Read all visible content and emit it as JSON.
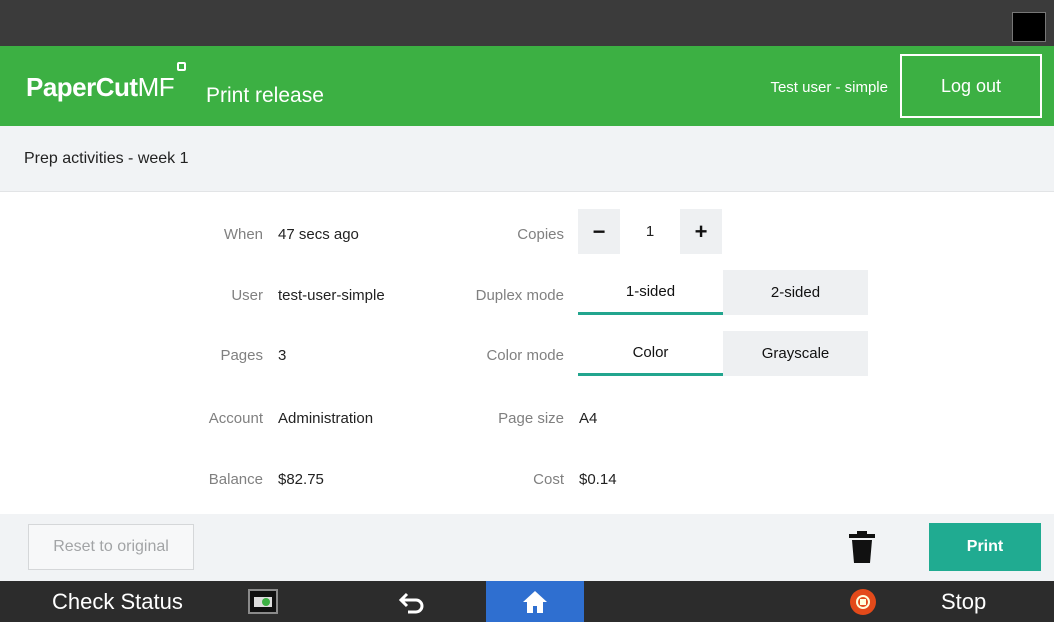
{
  "header": {
    "brand_main": "PaperCut",
    "brand_suffix": "MF",
    "title": "Print release",
    "user": "Test user - simple",
    "logout_label": "Log out"
  },
  "job": {
    "name": "Prep activities - week 1"
  },
  "details": {
    "when_label": "When",
    "when_value": "47 secs ago",
    "user_label": "User",
    "user_value": "test-user-simple",
    "pages_label": "Pages",
    "pages_value": "3",
    "account_label": "Account",
    "account_value": "Administration",
    "balance_label": "Balance",
    "balance_value": "$82.75",
    "copies_label": "Copies",
    "copies_value": "1",
    "copies_minus": "−",
    "copies_plus": "+",
    "duplex_label": "Duplex mode",
    "duplex_options": [
      "1-sided",
      "2-sided"
    ],
    "duplex_selected": "1-sided",
    "color_label": "Color mode",
    "color_options": [
      "Color",
      "Grayscale"
    ],
    "color_selected": "Color",
    "pagesize_label": "Page size",
    "pagesize_value": "A4",
    "cost_label": "Cost",
    "cost_value": "$0.14"
  },
  "actions": {
    "reset_label": "Reset to original",
    "print_label": "Print"
  },
  "device_bar": {
    "check_status_label": "Check Status",
    "stop_label": "Stop"
  },
  "icons": {
    "theme": "moon-icon",
    "delete": "trash-icon",
    "back": "back-arrow-icon",
    "home": "home-icon",
    "stop": "stop-icon",
    "status": "printer-status-icon"
  },
  "colors": {
    "header_green": "#3cb043",
    "accent_teal": "#20ab91",
    "home_blue": "#2f6fd0",
    "stop_orange": "#e34a1a"
  }
}
